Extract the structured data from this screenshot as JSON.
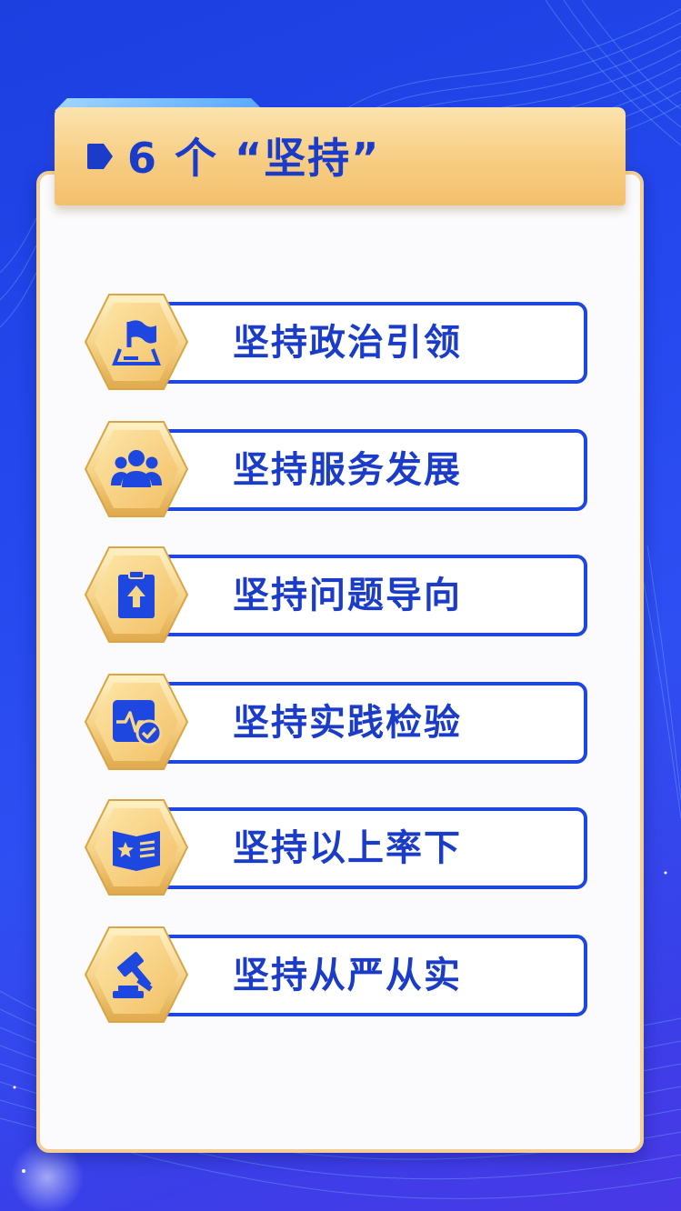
{
  "header": {
    "title": "6 个 “坚持”",
    "marker_icon": "tag-marker-icon"
  },
  "items": [
    {
      "label": "坚持政治引领",
      "icon": "flag-icon"
    },
    {
      "label": "坚持服务发展",
      "icon": "people-icon"
    },
    {
      "label": "坚持问题导向",
      "icon": "clipboard-arrow-icon"
    },
    {
      "label": "坚持实践检验",
      "icon": "pulse-check-icon"
    },
    {
      "label": "坚持以上率下",
      "icon": "star-document-icon"
    },
    {
      "label": "坚持从严从实",
      "icon": "gavel-icon"
    }
  ],
  "colors": {
    "primary_blue": "#1d47df",
    "gold": "#f3c06d",
    "card": "#fbfbfd"
  }
}
